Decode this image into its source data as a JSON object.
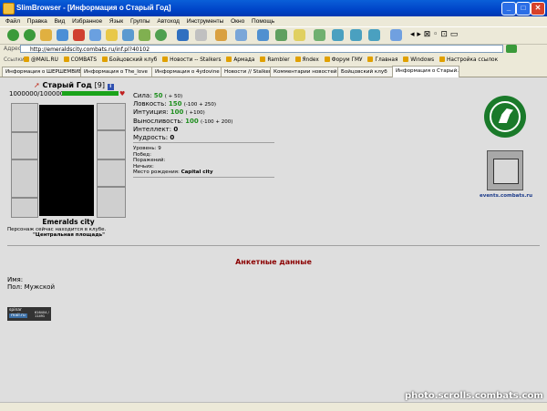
{
  "window": {
    "title": "SlimBrowser - [Информация о Старый Год]",
    "min": "_",
    "max": "□",
    "close": "✕"
  },
  "menu": [
    "Файл",
    "Правка",
    "Вид",
    "Избранное",
    "Язык",
    "Группы",
    "Автоход",
    "Инструменты",
    "Окно",
    "Помощь"
  ],
  "address": {
    "label": "Адрес",
    "url": "http://emeraldscity.combats.ru/inf.pl?40102"
  },
  "links": {
    "label": "Ссылки",
    "items": [
      "@MAIL.RU",
      "COMBATS",
      "Бойцовский клуб",
      "Новости -- Stalkers",
      "Армада",
      "Rambler",
      "Яndex",
      "Форум ГМУ",
      "Главная",
      "Windows",
      "Настройка ссылок"
    ]
  },
  "tabs": [
    "Информация о ШЕРШЕМВИЕ",
    "Информация о The_love",
    "Информация о 4ydovine",
    "Новости // Stalkers",
    "Комментарии новостей //...",
    "Бойцовский клуб",
    "Информация о Старый..."
  ],
  "character": {
    "name": "Старый Год",
    "level": "[9]",
    "info_icon": "i",
    "hp": "1000000/1000000",
    "city": "Emeralds city",
    "location_text": "Персонаж сейчас находится в клубе.",
    "location_place": "\"Центральная площадь\""
  },
  "stats": {
    "strength": {
      "label": "Сила:",
      "value": "50",
      "extra": "( + 50)"
    },
    "agility": {
      "label": "Ловкость:",
      "value": "150",
      "extra": "(-100 + 250)"
    },
    "intuition": {
      "label": "Интуиция:",
      "value": "100",
      "extra": "( +100)"
    },
    "endurance": {
      "label": "Выносливость:",
      "value": "100",
      "extra": "(-100 + 200)"
    },
    "intellect": {
      "label": "Интеллект:",
      "value": "0"
    },
    "wisdom": {
      "label": "Мудрость:",
      "value": "0"
    }
  },
  "info": {
    "level": "Уровень: 9",
    "wins": "Побед:",
    "losses": "Поражений:",
    "draws": "Ничьих:",
    "birthplace_label": "Место рождения:",
    "birthplace": "Capital city"
  },
  "events_link": "events.combats.ru",
  "anketa": {
    "title": "Анкетные данные",
    "name_label": "Имя:",
    "gender": "Пол: Мужской"
  },
  "counter": {
    "label1": "spinar",
    "label2": "mail.ru",
    "nums": "616404 / 11491"
  },
  "watermark": "photo.scrolls.combats.com",
  "colors": {
    "accent": "#1f8f1f",
    "heading": "#8b0000",
    "title_blue": "#0044c8"
  }
}
